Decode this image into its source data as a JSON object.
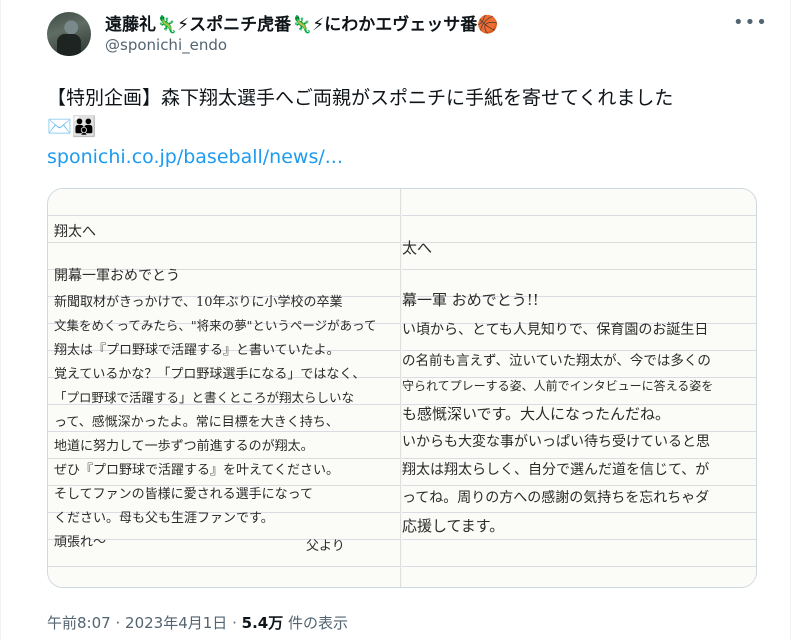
{
  "author": {
    "display_name": "遠藤礼🦎⚡スポニチ虎番🦎⚡にわかエヴェッサ番🏀",
    "handle": "@sponichi_endo"
  },
  "tweet": {
    "text": "【特別企画】森下翔太選手へご両親がスポニチに手紙を寄せてくれました",
    "emojis": "✉️👪",
    "link": "sponichi.co.jp/baseball/news/..."
  },
  "letter_left": {
    "lines": [
      "翔太へ",
      "",
      "開幕一軍おめでとう",
      "新聞取材がきっかけで、10年ぶりに小学校の卒業",
      "文集をめくってみたら、\"将来の夢\"というページがあって",
      "翔太は『プロ野球で活躍する』と書いていたよ。",
      "覚えているかな？「プロ野球選手になる」ではなく、",
      "「プロ野球で活躍する」と書くところが翔太らしいな",
      "って、感慨深かったよ。常に目標を大きく持ち、",
      "地道に努力して一歩ずつ前進するのが翔太。",
      "ぜひ『プロ野球で活躍する』を叶えてください。",
      "そしてファンの皆様に愛される選手になって",
      "ください。母も父も生涯ファンです。",
      "頑張れ〜",
      "",
      "父より"
    ]
  },
  "letter_right": {
    "lines": [
      "太へ",
      "",
      "幕一軍 おめでとう!!",
      "い頃から、とても人見知りで、保育園のお誕生日",
      "の名前も言えず、泣いていた翔太が、今では多くの",
      "守られてプレーする姿、人前でインタビューに答える姿を",
      "も感慨深いです。大人になったんだね。",
      "いからも大変な事がいっぱい待ち受けていると思",
      "翔太は翔太らしく、自分で選んだ道を信じて、が",
      "ってね。周りの方への感謝の気持ちを忘れちゃダ",
      "応援してます。"
    ]
  },
  "meta": {
    "time": "午前8:07",
    "sep1": "·",
    "date": "2023年4月1日",
    "sep2": "·",
    "views_count": "5.4万",
    "views_label": "件の表示"
  }
}
